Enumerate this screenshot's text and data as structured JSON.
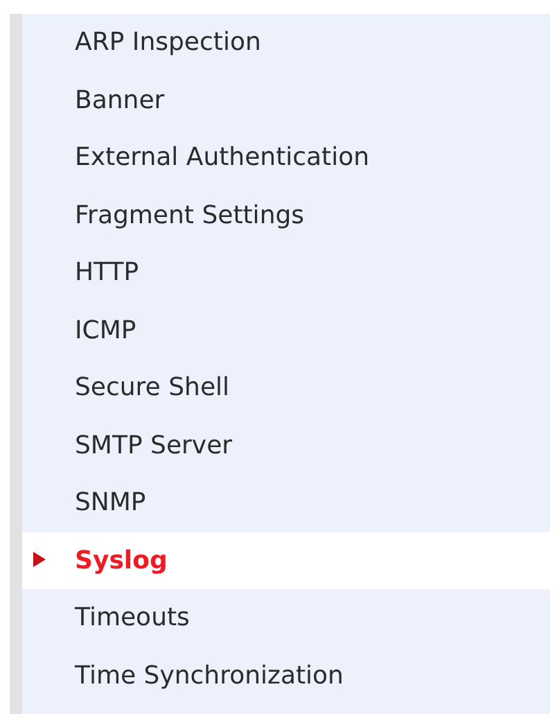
{
  "menu": {
    "items": [
      {
        "label": "ARP Inspection",
        "selected": false
      },
      {
        "label": "Banner",
        "selected": false
      },
      {
        "label": "External Authentication",
        "selected": false
      },
      {
        "label": "Fragment Settings",
        "selected": false
      },
      {
        "label": "HTTP",
        "selected": false
      },
      {
        "label": "ICMP",
        "selected": false
      },
      {
        "label": "Secure Shell",
        "selected": false
      },
      {
        "label": "SMTP Server",
        "selected": false
      },
      {
        "label": "SNMP",
        "selected": false
      },
      {
        "label": "Syslog",
        "selected": true
      },
      {
        "label": "Timeouts",
        "selected": false
      },
      {
        "label": "Time Synchronization",
        "selected": false
      }
    ]
  }
}
